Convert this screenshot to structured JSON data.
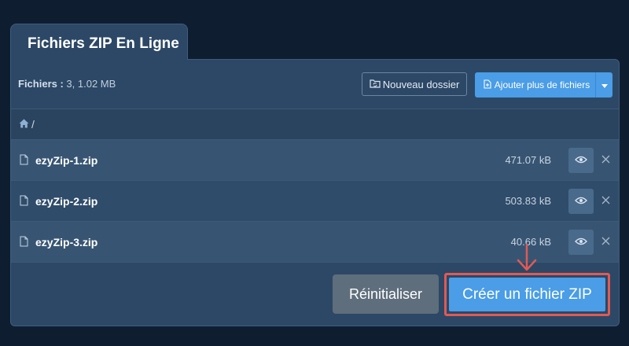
{
  "tab": {
    "title": "Fichiers ZIP En Ligne"
  },
  "toolbar": {
    "files_label": "Fichiers :",
    "files_summary": "3, 1.02 MB",
    "new_folder_label": "Nouveau dossier",
    "add_files_label": "Ajouter plus de fichiers"
  },
  "breadcrumb": {
    "separator": "/"
  },
  "files": [
    {
      "name": "ezyZip-1.zip",
      "size": "471.07 kB"
    },
    {
      "name": "ezyZip-2.zip",
      "size": "503.83 kB"
    },
    {
      "name": "ezyZip-3.zip",
      "size": "40.66 kB"
    }
  ],
  "actions": {
    "reset_label": "Réinitialiser",
    "create_label": "Créer un fichier ZIP"
  },
  "colors": {
    "background": "#0e1e30",
    "panel": "#2c4866",
    "accent": "#4a9de6",
    "highlight": "#e05a55"
  },
  "icons": [
    "folder-sync-icon",
    "add-file-icon",
    "caret-down-icon",
    "home-icon",
    "file-icon",
    "eye-icon",
    "close-icon",
    "arrow-down-icon"
  ]
}
